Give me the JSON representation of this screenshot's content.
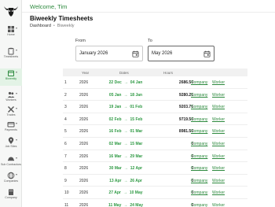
{
  "topbar": {
    "welcome": "Welcome, Tim"
  },
  "page": {
    "title": "Biweekly Timesheets"
  },
  "breadcrumb": {
    "items": [
      "Dashboard",
      "Biweekly"
    ]
  },
  "filters": {
    "from_label": "From",
    "from_value": "January 2026",
    "to_label": "To",
    "to_value": "May 2026"
  },
  "sidebar": {
    "items": [
      {
        "label": "Home",
        "icon": "dashboard-icon"
      },
      {
        "label": "Timesheets",
        "icon": "clipboard-icon"
      },
      {
        "label": "Biweekly",
        "icon": "calendar-icon"
      },
      {
        "label": "Workers",
        "icon": "people-icon"
      },
      {
        "label": "Trades",
        "icon": "tools-icon"
      },
      {
        "label": "Payments",
        "icon": "payment-icon"
      },
      {
        "label": "Job Sites",
        "icon": "location-icon"
      },
      {
        "label": "Sub Contractors",
        "icon": "contractor-icon"
      },
      {
        "label": "Companies",
        "icon": "company-icon"
      },
      {
        "label": "Company",
        "icon": "building-icon"
      }
    ]
  },
  "table": {
    "headers": [
      "",
      "Year",
      "Dates",
      "Hours",
      ""
    ],
    "company_label": "Company",
    "worker_label": "Worker",
    "rows": [
      {
        "idx": "1",
        "year": "2026",
        "start": "22 Dec",
        "end": "04 Jan",
        "hours": "2686.50"
      },
      {
        "idx": "2",
        "year": "2026",
        "start": "05 Jan",
        "end": "18 Jan",
        "hours": "9280.25"
      },
      {
        "idx": "3",
        "year": "2026",
        "start": "19 Jan",
        "end": "01 Feb",
        "hours": "9203.75"
      },
      {
        "idx": "4",
        "year": "2026",
        "start": "02 Feb",
        "end": "15 Feb",
        "hours": "9719.50"
      },
      {
        "idx": "5",
        "year": "2026",
        "start": "16 Feb",
        "end": "01 Mar",
        "hours": "8981.50"
      },
      {
        "idx": "6",
        "year": "2026",
        "start": "02 Mar",
        "end": "15 Mar",
        "hours": "0"
      },
      {
        "idx": "7",
        "year": "2026",
        "start": "16 Mar",
        "end": "29 Mar",
        "hours": "0"
      },
      {
        "idx": "8",
        "year": "2026",
        "start": "30 Mar",
        "end": "12 Apr",
        "hours": "0"
      },
      {
        "idx": "9",
        "year": "2026",
        "start": "13 Apr",
        "end": "26 Apr",
        "hours": "0"
      },
      {
        "idx": "10",
        "year": "2026",
        "start": "27 Apr",
        "end": "10 May",
        "hours": "0"
      },
      {
        "idx": "11",
        "year": "2026",
        "start": "11 May",
        "end": "24 May",
        "hours": "0"
      }
    ]
  },
  "colors": {
    "accent": "#2d8a3e",
    "date_green": "#2f9a44"
  }
}
